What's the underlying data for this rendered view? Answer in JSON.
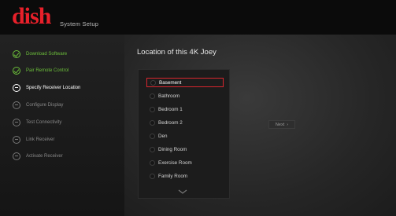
{
  "header": {
    "logo_text": "dish",
    "title": "System Setup",
    "brand_color": "#e8202a"
  },
  "sidebar": {
    "steps": [
      {
        "label": "Download Software",
        "state": "done"
      },
      {
        "label": "Pair Remote Control",
        "state": "done"
      },
      {
        "label": "Specify Receiver Location",
        "state": "current"
      },
      {
        "label": "Configure Display",
        "state": "pending"
      },
      {
        "label": "Test Connectivity",
        "state": "pending"
      },
      {
        "label": "Link Receiver",
        "state": "pending"
      },
      {
        "label": "Activate Receiver",
        "state": "pending"
      }
    ]
  },
  "main": {
    "title": "Location of this 4K Joey",
    "options": [
      "Basement",
      "Bathroom",
      "Bedroom 1",
      "Bedroom 2",
      "Den",
      "Dining Room",
      "Exercise Room",
      "Family Room"
    ],
    "selected": "Basement",
    "next_label": "Next"
  },
  "colors": {
    "done": "#6cbf3a",
    "selected_border": "#d8262e"
  }
}
